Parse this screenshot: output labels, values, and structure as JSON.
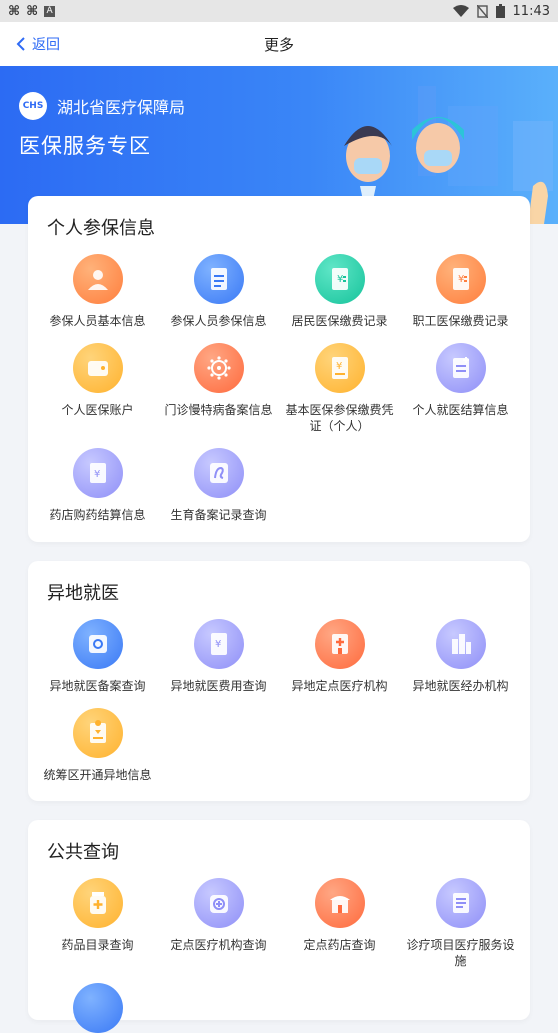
{
  "statusbar": {
    "time": "11:43",
    "left_icons": [
      "app-icon-1",
      "app-icon-2",
      "notification-icon"
    ],
    "right_icons": [
      "wifi-icon",
      "no-sim-icon",
      "battery-icon"
    ]
  },
  "nav": {
    "back_label": "返回",
    "title": "更多"
  },
  "banner": {
    "org_name": "湖北省医疗保障局",
    "logo_text": "CHS",
    "title": "医保服务专区"
  },
  "sections": [
    {
      "title": "个人参保信息",
      "items": [
        {
          "label": "参保人员基本信息",
          "color": "orange",
          "icon": "person-icon"
        },
        {
          "label": "参保人员参保信息",
          "color": "blue",
          "icon": "document-icon"
        },
        {
          "label": "居民医保缴费记录",
          "color": "teal",
          "icon": "receipt-icon"
        },
        {
          "label": "职工医保缴费记录",
          "color": "orange",
          "icon": "receipt-icon"
        },
        {
          "label": "个人医保账户",
          "color": "yellow",
          "icon": "wallet-icon"
        },
        {
          "label": "门诊慢特病备案信息",
          "color": "red",
          "icon": "virus-icon"
        },
        {
          "label": "基本医保参保缴费凭证（个人）",
          "color": "yellow",
          "icon": "voucher-icon"
        },
        {
          "label": "个人就医结算信息",
          "color": "purple",
          "icon": "settlement-icon"
        },
        {
          "label": "药店购药结算信息",
          "color": "purple",
          "icon": "pharmacy-bill-icon"
        },
        {
          "label": "生育备案记录查询",
          "color": "purple",
          "icon": "birth-icon"
        }
      ]
    },
    {
      "title": "异地就医",
      "items": [
        {
          "label": "异地就医备案查询",
          "color": "blue",
          "icon": "record-icon"
        },
        {
          "label": "异地就医费用查询",
          "color": "purple",
          "icon": "fee-icon"
        },
        {
          "label": "异地定点医疗机构",
          "color": "red",
          "icon": "hospital-icon"
        },
        {
          "label": "异地就医经办机构",
          "color": "purple",
          "icon": "building-icon"
        },
        {
          "label": "统筹区开通异地信息",
          "color": "yellow",
          "icon": "location-doc-icon"
        }
      ]
    },
    {
      "title": "公共查询",
      "items": [
        {
          "label": "药品目录查询",
          "color": "yellow",
          "icon": "medicine-icon"
        },
        {
          "label": "定点医疗机构查询",
          "color": "purple",
          "icon": "medical-kit-icon"
        },
        {
          "label": "定点药店查询",
          "color": "red",
          "icon": "store-icon"
        },
        {
          "label": "诊疗项目医疗服务设施",
          "color": "purple",
          "icon": "list-icon"
        }
      ]
    }
  ]
}
